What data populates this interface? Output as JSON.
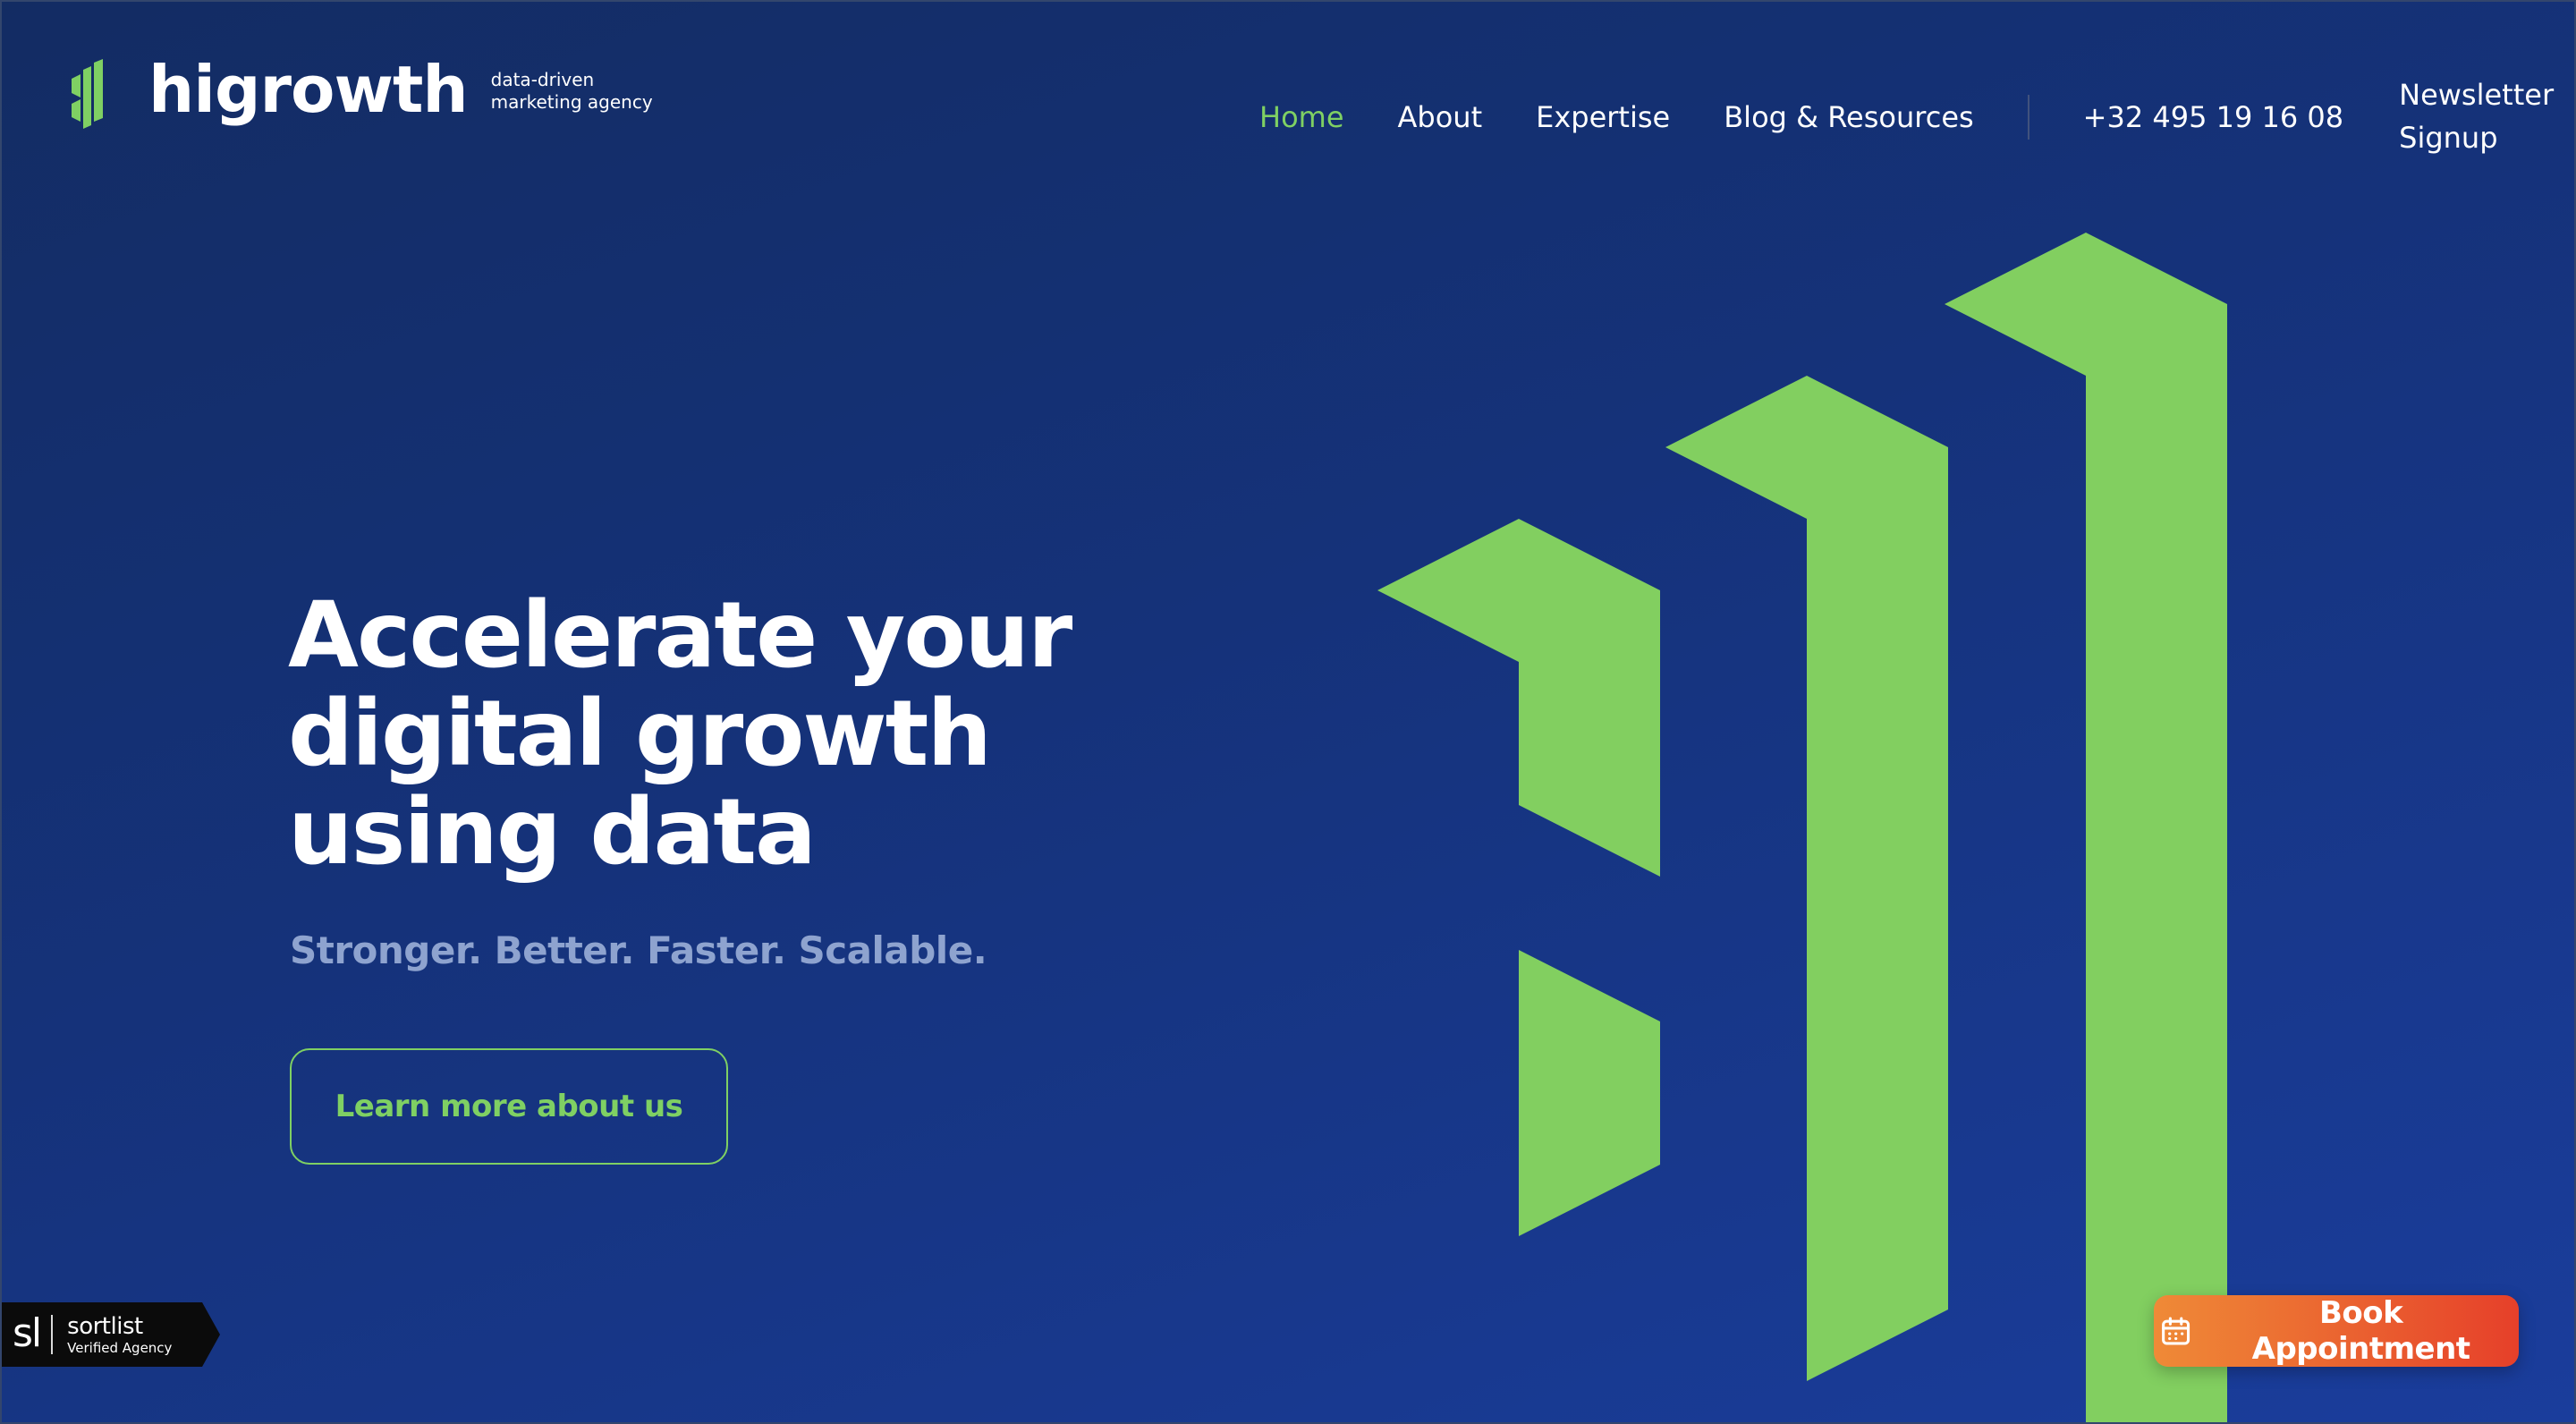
{
  "header": {
    "logo_name": "higrowth",
    "logo_tagline_line1": "data-driven",
    "logo_tagline_line2": "marketing agency"
  },
  "nav": {
    "items": [
      {
        "label": "Home",
        "active": true
      },
      {
        "label": "About",
        "active": false
      },
      {
        "label": "Expertise",
        "active": false
      },
      {
        "label": "Blog & Resources",
        "active": false
      }
    ],
    "phone": "+32 495 19 16 08",
    "newsletter_line1": "Newsletter",
    "newsletter_line2": "Signup"
  },
  "hero": {
    "title_line1": "Accelerate your",
    "title_line2": "digital growth",
    "title_line3": "using data",
    "subtitle": "Stronger. Better. Faster. Scalable.",
    "cta_label": "Learn more about us"
  },
  "badge": {
    "mark": "sl",
    "name": "sortlist",
    "subtitle": "Verified Agency"
  },
  "book": {
    "label": "Book Appointment",
    "icon": "calendar-icon"
  },
  "colors": {
    "accent_green": "#7fd063",
    "background_top": "#132c63",
    "background_bottom": "#1a3d9c",
    "cta_orange": "#ef8a37",
    "cta_red": "#e6402a",
    "subtitle": "#8ea3cf"
  }
}
